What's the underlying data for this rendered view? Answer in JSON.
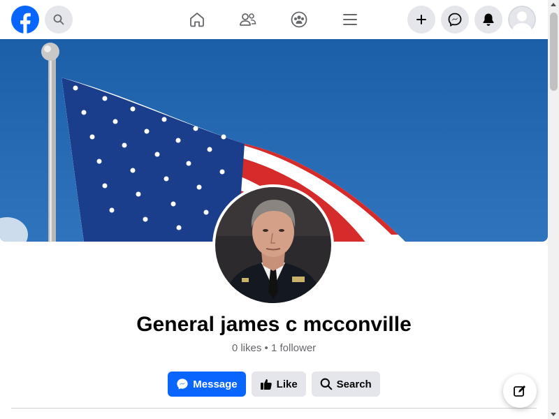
{
  "profile": {
    "name": "General james c mcconville",
    "likes": "0 likes",
    "separator": "•",
    "followers": "1 follower"
  },
  "actions": {
    "message_label": "Message",
    "like_label": "Like",
    "search_label": "Search"
  },
  "nav": {
    "icons": [
      "home-icon",
      "friends-icon",
      "groups-icon",
      "menu-icon"
    ],
    "right_icons": [
      "plus-icon",
      "messenger-icon",
      "bell-icon",
      "account-avatar"
    ]
  },
  "colors": {
    "brand": "#0866ff",
    "secondary_button": "#e4e6eb",
    "muted_text": "#65676b"
  }
}
